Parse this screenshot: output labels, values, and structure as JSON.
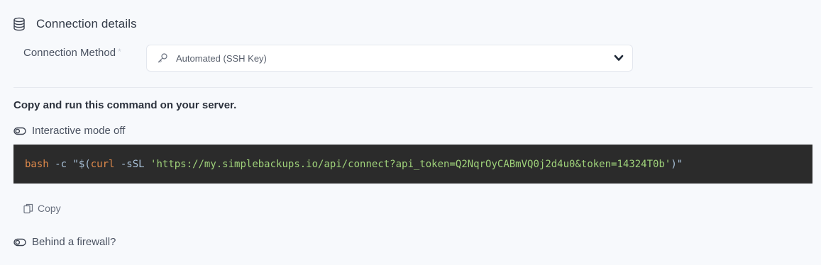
{
  "section": {
    "title": "Connection details",
    "icon": "database-icon"
  },
  "connection_method": {
    "label": "Connection Method",
    "required_marker": "*",
    "selected_value": "Automated (SSH Key)",
    "icon": "key-icon",
    "dropdown_icon": "chevron-down-icon"
  },
  "instruction": "Copy and run this command on your server.",
  "interactive_toggle": {
    "label": "Interactive mode off",
    "state": "off"
  },
  "command": {
    "part_bash": "bash",
    "part_flag": " -c ",
    "part_open": "\"$(",
    "part_curl": "curl",
    "part_curl_flag": " -sSL ",
    "part_url": "'https://my.simplebackups.io/api/connect?api_token=Q2NqrOyCABmVQ0j2d4u0&token=14324T0b'",
    "part_close": ")\""
  },
  "copy_button": {
    "label": "Copy",
    "icon": "copy-icon"
  },
  "firewall_toggle": {
    "label": "Behind a firewall?",
    "state": "off"
  },
  "colors": {
    "background": "#f7f9fc",
    "code_background": "#2b2b2b",
    "command_keyword": "#e08a4b",
    "string": "#9fd27a"
  }
}
